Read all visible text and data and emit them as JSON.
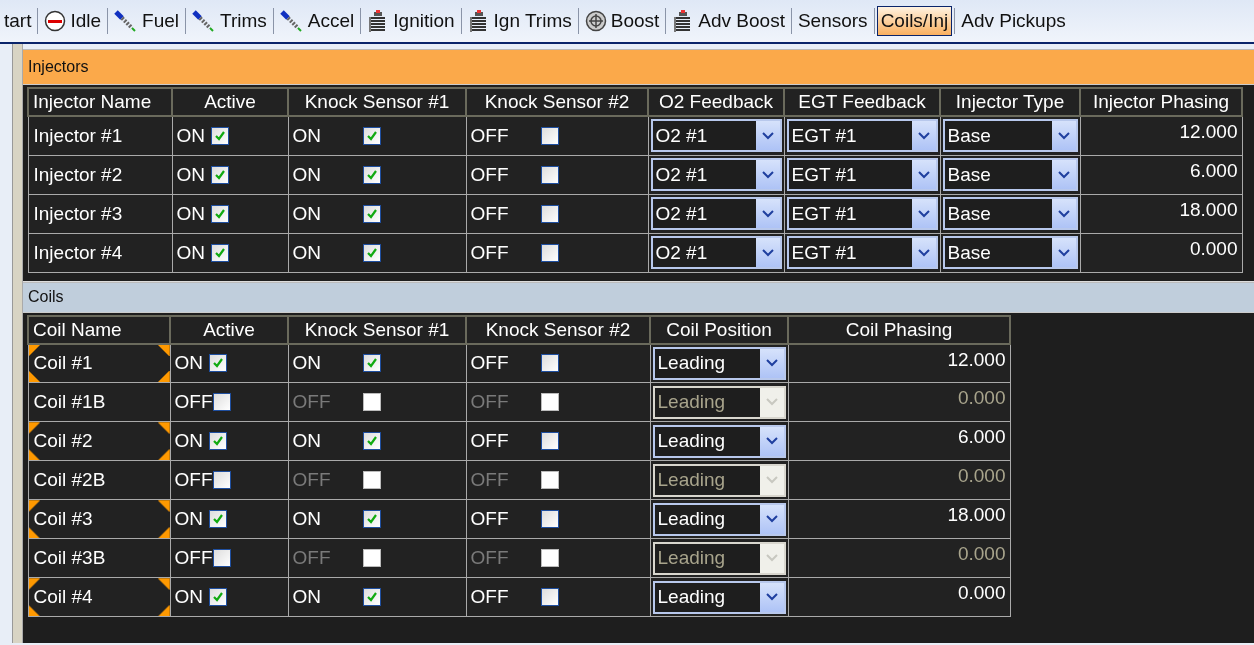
{
  "tabs": [
    {
      "label": "tart",
      "selected": false
    },
    {
      "label": "Idle",
      "kind": "gauge",
      "selected": false
    },
    {
      "label": "Fuel",
      "kind": "injector",
      "selected": false
    },
    {
      "label": "Trims",
      "kind": "injector",
      "selected": false
    },
    {
      "label": "Accel",
      "kind": "injector",
      "selected": false
    },
    {
      "label": "Ignition",
      "kind": "coil",
      "selected": false
    },
    {
      "label": "Ign Trims",
      "kind": "coil",
      "selected": false
    },
    {
      "label": "Boost",
      "kind": "turbo",
      "selected": false
    },
    {
      "label": "Adv Boost",
      "kind": "coil",
      "selected": false
    },
    {
      "label": "Sensors",
      "selected": false
    },
    {
      "label": "Coils/Inj",
      "selected": true
    },
    {
      "label": "Adv Pickups",
      "selected": false
    }
  ],
  "injectors": {
    "title": "Injectors",
    "columns": [
      {
        "label": "Injector Name",
        "kind": "name"
      },
      {
        "label": "Active",
        "kind": "check"
      },
      {
        "label": "Knock Sensor #1",
        "kind": "check"
      },
      {
        "label": "Knock Sensor #2",
        "kind": "check"
      },
      {
        "label": "O2 Feedback",
        "kind": "select"
      },
      {
        "label": "EGT Feedback",
        "kind": "select"
      },
      {
        "label": "Injector Type",
        "kind": "select"
      },
      {
        "label": "Injector Phasing",
        "kind": "number"
      }
    ],
    "rows": [
      {
        "cells": [
          {
            "text": "Injector #1"
          },
          {
            "label": "ON",
            "checked": true
          },
          {
            "label": "ON",
            "checked": true
          },
          {
            "label": "OFF",
            "checked": false
          },
          {
            "value": "O2 #1"
          },
          {
            "value": "EGT #1"
          },
          {
            "value": "Base"
          },
          {
            "value": "12.000"
          }
        ]
      },
      {
        "cells": [
          {
            "text": "Injector #2"
          },
          {
            "label": "ON",
            "checked": true
          },
          {
            "label": "ON",
            "checked": true
          },
          {
            "label": "OFF",
            "checked": false
          },
          {
            "value": "O2 #1"
          },
          {
            "value": "EGT #1"
          },
          {
            "value": "Base"
          },
          {
            "value": "6.000"
          }
        ]
      },
      {
        "cells": [
          {
            "text": "Injector #3"
          },
          {
            "label": "ON",
            "checked": true
          },
          {
            "label": "ON",
            "checked": true
          },
          {
            "label": "OFF",
            "checked": false
          },
          {
            "value": "O2 #1"
          },
          {
            "value": "EGT #1"
          },
          {
            "value": "Base"
          },
          {
            "value": "18.000"
          }
        ]
      },
      {
        "cells": [
          {
            "text": "Injector #4"
          },
          {
            "label": "ON",
            "checked": true
          },
          {
            "label": "ON",
            "checked": true
          },
          {
            "label": "OFF",
            "checked": false
          },
          {
            "value": "O2 #1"
          },
          {
            "value": "EGT #1"
          },
          {
            "value": "Base"
          },
          {
            "value": "0.000"
          }
        ]
      }
    ]
  },
  "coils": {
    "title": "Coils",
    "columns": [
      {
        "label": "Coil Name",
        "kind": "name"
      },
      {
        "label": "Active",
        "kind": "check"
      },
      {
        "label": "Knock Sensor #1",
        "kind": "check"
      },
      {
        "label": "Knock Sensor #2",
        "kind": "check"
      },
      {
        "label": "Coil Position",
        "kind": "select"
      },
      {
        "label": "Coil Phasing",
        "kind": "number"
      }
    ],
    "rows": [
      {
        "cells": [
          {
            "text": "Coil #1",
            "marked": true
          },
          {
            "label": "ON",
            "checked": true
          },
          {
            "label": "ON",
            "checked": true,
            "disabled": false
          },
          {
            "label": "OFF",
            "checked": false,
            "disabled": false
          },
          {
            "value": "Leading",
            "disabled": false
          },
          {
            "value": "12.000",
            "disabled": false
          }
        ]
      },
      {
        "cells": [
          {
            "text": "Coil #1B",
            "marked": false
          },
          {
            "label": "OFF",
            "checked": false
          },
          {
            "label": "OFF",
            "checked": false,
            "disabled": true
          },
          {
            "label": "OFF",
            "checked": false,
            "disabled": true
          },
          {
            "value": "Leading",
            "disabled": true
          },
          {
            "value": "0.000",
            "disabled": true
          }
        ]
      },
      {
        "cells": [
          {
            "text": "Coil #2",
            "marked": true
          },
          {
            "label": "ON",
            "checked": true
          },
          {
            "label": "ON",
            "checked": true,
            "disabled": false
          },
          {
            "label": "OFF",
            "checked": false,
            "disabled": false
          },
          {
            "value": "Leading",
            "disabled": false
          },
          {
            "value": "6.000",
            "disabled": false
          }
        ]
      },
      {
        "cells": [
          {
            "text": "Coil #2B",
            "marked": false
          },
          {
            "label": "OFF",
            "checked": false
          },
          {
            "label": "OFF",
            "checked": false,
            "disabled": true
          },
          {
            "label": "OFF",
            "checked": false,
            "disabled": true
          },
          {
            "value": "Leading",
            "disabled": true
          },
          {
            "value": "0.000",
            "disabled": true
          }
        ]
      },
      {
        "cells": [
          {
            "text": "Coil #3",
            "marked": true
          },
          {
            "label": "ON",
            "checked": true
          },
          {
            "label": "ON",
            "checked": true,
            "disabled": false
          },
          {
            "label": "OFF",
            "checked": false,
            "disabled": false
          },
          {
            "value": "Leading",
            "disabled": false
          },
          {
            "value": "18.000",
            "disabled": false
          }
        ]
      },
      {
        "cells": [
          {
            "text": "Coil #3B",
            "marked": false
          },
          {
            "label": "OFF",
            "checked": false
          },
          {
            "label": "OFF",
            "checked": false,
            "disabled": true
          },
          {
            "label": "OFF",
            "checked": false,
            "disabled": true
          },
          {
            "value": "Leading",
            "disabled": true
          },
          {
            "value": "0.000",
            "disabled": true
          }
        ]
      },
      {
        "cells": [
          {
            "text": "Coil #4",
            "marked": true
          },
          {
            "label": "ON",
            "checked": true
          },
          {
            "label": "ON",
            "checked": true,
            "disabled": false
          },
          {
            "label": "OFF",
            "checked": false,
            "disabled": false
          },
          {
            "value": "Leading",
            "disabled": false
          },
          {
            "value": "0.000",
            "disabled": false
          }
        ]
      }
    ]
  }
}
